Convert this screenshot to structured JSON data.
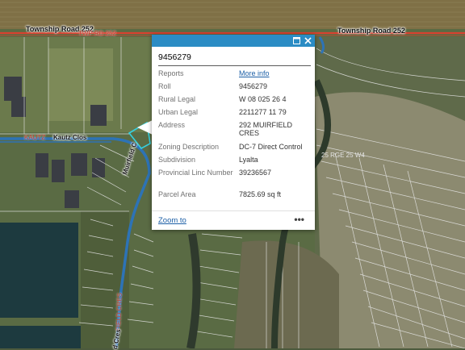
{
  "map": {
    "roads": {
      "township_road_left": "Township Road 252",
      "township_road_right": "Township Road 252",
      "twp_rd_overlay": "TWP RD 252",
      "kautz_red": "KAUTZ",
      "kautz_clos": "Kautz Clos",
      "muirfield_vertical": "Muirfield C",
      "muirfield_red": "FIELD CRES",
      "bottom_cres": "d Cres",
      "rge_label": "25 RGE 25 W4"
    },
    "colors": {
      "township_road": "#d9412f",
      "kautz_road": "#2d73b6",
      "popup_titlebar": "#2b8cc4",
      "selected_parcel": "#35d1e0"
    }
  },
  "popup": {
    "title": "9456279",
    "titlebar_icons": [
      "maximize-icon",
      "close-icon"
    ],
    "rows": [
      {
        "label": "Reports",
        "value": "More info",
        "link": true
      },
      {
        "label": "Roll",
        "value": "9456279"
      },
      {
        "label": "Rural Legal",
        "value": "W 08 025 26 4"
      },
      {
        "label": "Urban Legal",
        "value": "2211277 11 79"
      },
      {
        "label": "Address",
        "value": "292 MUIRFIELD CRES"
      },
      {
        "label": "Zoning Description",
        "value": "DC-7 Direct Control"
      },
      {
        "label": "Subdivision",
        "value": "Lyalta"
      },
      {
        "label": "Provincial Linc Number",
        "value": "39236567"
      },
      {
        "label": "Parcel Area",
        "value": "7825.69 sq ft"
      }
    ],
    "zoom_to": "Zoom to",
    "more_actions": "•••"
  }
}
